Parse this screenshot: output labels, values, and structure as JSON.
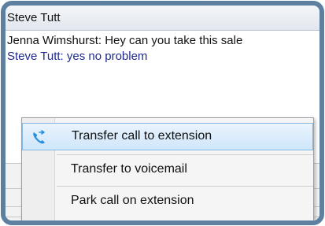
{
  "window": {
    "title": "Steve Tutt"
  },
  "chat": {
    "messages": [
      {
        "text": "Jenna Wimshurst: Hey can you take this sale"
      },
      {
        "text": "Steve Tutt: yes no problem"
      }
    ]
  },
  "context_menu": {
    "items": [
      {
        "label": "Transfer call to extension",
        "icon": "phone-transfer-icon",
        "highlighted": true
      },
      {
        "label": "Transfer to voicemail"
      },
      {
        "label": "Park call on extension"
      }
    ]
  },
  "colors": {
    "frame": "#5d7fa0",
    "highlight": "#cfe6fb",
    "highlight_border": "#84b8e4",
    "self_message": "#1f2a8c",
    "icon": "#2a8fd8"
  }
}
